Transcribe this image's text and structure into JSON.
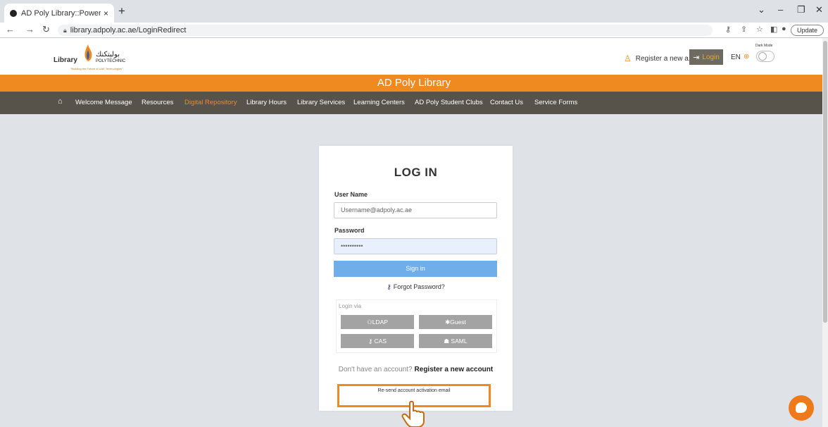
{
  "browser": {
    "tab_title": "AD Poly Library::Powered by Dev",
    "tab_close": "×",
    "new_tab": "+",
    "url": "library.adpoly.ac.ae/LoginRedirect",
    "update_label": "Update",
    "controls": {
      "minimize": "–",
      "restore": "❐",
      "close": "✕",
      "dropdown": "⌄"
    }
  },
  "header": {
    "logo_library_text": "Library",
    "logo_polytechnic": "POLYTECHNIC",
    "logo_arabic": "بوليتكنك",
    "logo_tagline": "\"Building the Future of UAE Technologies\"",
    "register_label": "Register a new a...",
    "login_label": "Login",
    "language": "EN",
    "dark_mode_label": "Dark Mode"
  },
  "banner": {
    "title": "AD Poly Library"
  },
  "nav": {
    "items": [
      {
        "label": "Welcome Message"
      },
      {
        "label": "Resources"
      },
      {
        "label": "Digital Repository"
      },
      {
        "label": "Library Hours"
      },
      {
        "label": "Library Services"
      },
      {
        "label": "Learning Centers"
      },
      {
        "label": "AD Poly Student Clubs"
      },
      {
        "label": "Contact Us"
      },
      {
        "label": "Service Forms"
      }
    ]
  },
  "login": {
    "title": "LOG IN",
    "username_label": "User Name",
    "username_value": "Username@adpoly.ac.ae",
    "password_label": "Password",
    "password_value": "••••••••••",
    "signin_label": "Sign in",
    "forgot_label": "Forgot Password?",
    "login_via_label": "Login via",
    "ldap_label": "LDAP",
    "guest_label": "Guest",
    "cas_label": "CAS",
    "saml_label": "SAML",
    "no_account_text": "Don't have an account?",
    "register_link": "Register a new account",
    "resend_label": "Re-send account activation email"
  },
  "colors": {
    "brand_orange": "#ef8a21",
    "nav_bg": "#57524a",
    "signin_blue": "#6faee8"
  }
}
